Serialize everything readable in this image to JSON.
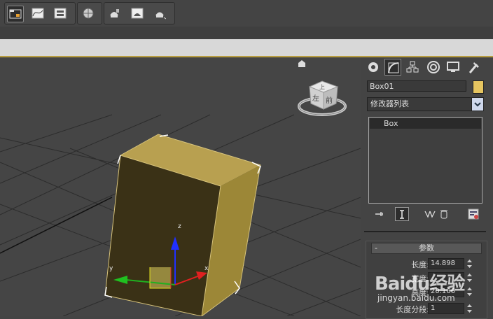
{
  "toolbar": {
    "buttons": [
      "scene-explorer",
      "curve-editor",
      "schematic-view",
      "material-editor",
      "render-setup",
      "rendered-frame-window",
      "render-production"
    ]
  },
  "viewport": {
    "axis_x": "x",
    "axis_y": "y",
    "axis_z": "z",
    "viewcube_top": "上",
    "viewcube_front": "前",
    "viewcube_left": "左"
  },
  "panel": {
    "tabs": [
      "create",
      "modify",
      "hierarchy",
      "motion",
      "display",
      "utilities"
    ],
    "object_name": "Box01",
    "object_color": "#e6c560",
    "modifier_list": "修改器列表",
    "stack_items": [
      "Box"
    ],
    "parameters": {
      "title": "参数",
      "collapse": "-",
      "rows": [
        {
          "label": "长度:",
          "value": "14.898"
        },
        {
          "label": "宽度:",
          "value": ""
        },
        {
          "label": "高度:",
          "value": "20.166"
        },
        {
          "label": "长度分段:",
          "value": "1"
        }
      ]
    }
  },
  "watermark": {
    "brand": "Baidu经验",
    "url": "jingyan.baidu.com"
  }
}
